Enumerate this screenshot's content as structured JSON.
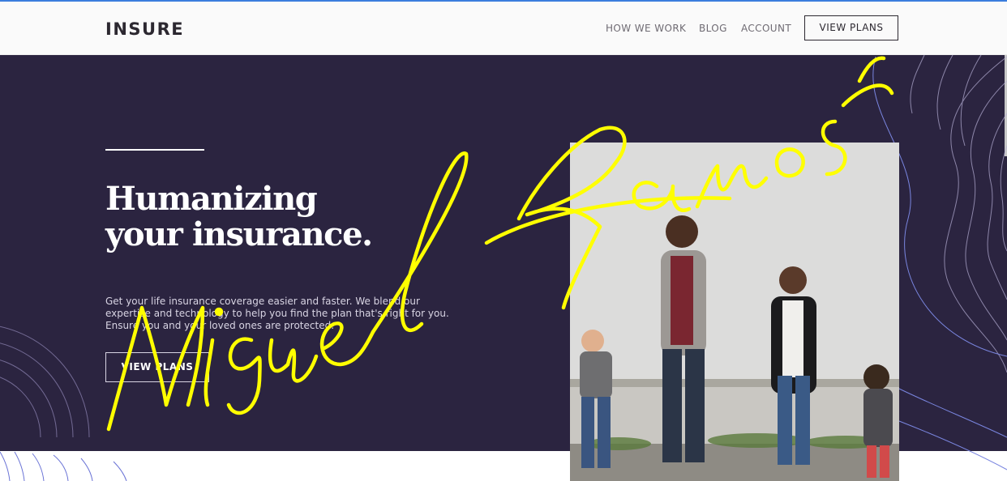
{
  "header": {
    "logo": "INSURE",
    "nav": [
      {
        "label": "HOW WE WORK"
      },
      {
        "label": "BLOG"
      },
      {
        "label": "ACCOUNT"
      }
    ],
    "cta": "VIEW PLANS"
  },
  "hero": {
    "title_line1": "Humanizing",
    "title_line2": "your insurance.",
    "description": "Get your life insurance coverage easier and faster. We blend our expertise and technology to help you find the plan that's right for you. Ensure you and your loved ones are protected.",
    "cta": "VIEW PLANS"
  },
  "overlay": {
    "signature_text": "Miguel Ramos",
    "signature_color": "#ffff00"
  },
  "colors": {
    "hero_bg": "#2b2440",
    "header_bg": "#fafafa",
    "accent": "#3b7ddd"
  }
}
